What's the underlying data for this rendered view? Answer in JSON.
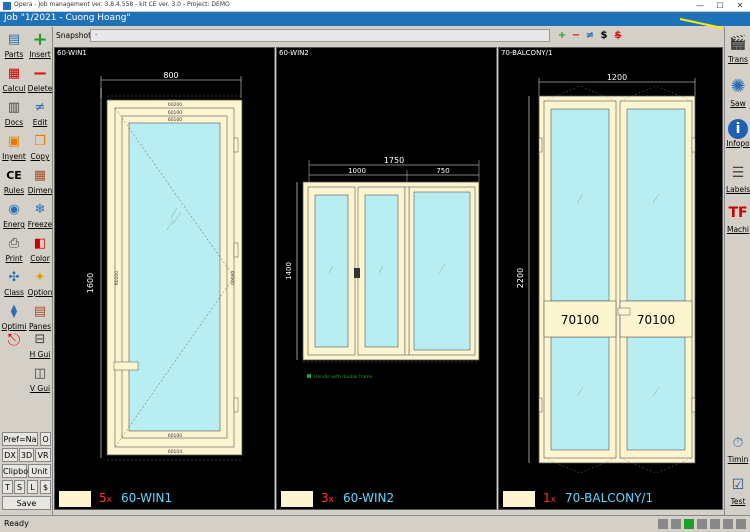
{
  "titlebar": {
    "app_title": "Opera - Job management ver. 3.8.4.558 - kit CE ver. 3.0 - Project: DEMO",
    "minimize": "—",
    "maximize": "☐",
    "close": "✕"
  },
  "job": {
    "title": "Job \"1/2021 - Cuong Hoang\""
  },
  "snapshot": {
    "label": "Snapshot:",
    "value": "-"
  },
  "snap_tools": {
    "add": "+",
    "remove": "−",
    "swap": "≠",
    "price": "$",
    "noprice": "$"
  },
  "left_toolbar": {
    "parts": "Parts",
    "insert": "Insert",
    "calcul": "Calcul",
    "delete": "Delete",
    "docs": "Docs",
    "edit": "Edit",
    "inventory": "Inyent",
    "copy": "Copy",
    "rules": "Rules",
    "dimen": "Dimen",
    "energ": "Energ",
    "freeze": "Freeze",
    "print": "Print",
    "color": "Color",
    "class": "Class",
    "option": "Option",
    "optimi": "Optimi",
    "panes": "Panes",
    "hgui": "H Gui",
    "vgui": "V Gui",
    "pref": "Pref=Na",
    "o": "O",
    "dx": "DX",
    "d3": "3D",
    "vr": "VR",
    "clipbo": "Clipbo",
    "unit": "Unit",
    "t": "T",
    "s": "S",
    "l": "L",
    "dollar": "$",
    "save": "Save"
  },
  "right_toolbar": {
    "trans": "Trans",
    "saw": "Saw",
    "infopo": "Infopo",
    "labels": "Labels",
    "machi": "Machi",
    "timin": "Timin",
    "test": "Test"
  },
  "panels": [
    {
      "head": "60-WIN1",
      "qty": "5",
      "name": "60-WIN1",
      "dims": {
        "width": "800",
        "height": "1600"
      },
      "profile_labels": [
        "60200",
        "60100",
        "60100",
        "60104",
        "60100",
        "60100",
        "60100"
      ]
    },
    {
      "head": "60-WIN2",
      "qty": "3",
      "name": "60-WIN2",
      "dims": {
        "total": "1750",
        "left": "1000",
        "right": "750",
        "height": "1400"
      },
      "note": "Handle with double frame"
    },
    {
      "head": "70-BALCONY/1",
      "qty": "1",
      "name": "70-BALCONY/1",
      "dims": {
        "width": "1200",
        "height": "2200"
      },
      "profile_labels": [
        "70100",
        "70100"
      ]
    }
  ],
  "qty_suffix": "x",
  "status": {
    "text": "Ready"
  },
  "colors": {
    "frame": "#fdf5d0",
    "glass": "#b8eef2",
    "accent": "#1f72b8",
    "qty": "#ff3333",
    "name": "#5fd8ff"
  }
}
